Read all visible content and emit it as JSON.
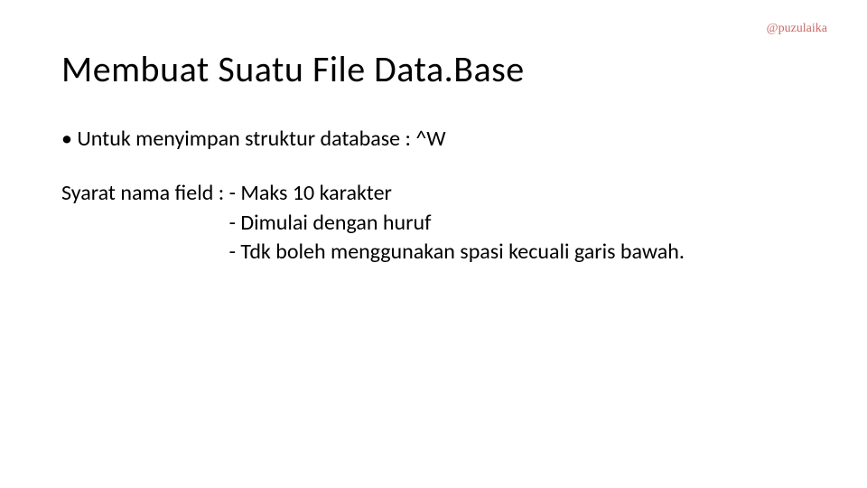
{
  "watermark": "@puzulaika",
  "title": "Membuat Suatu File Data.Base",
  "bullet1": "Untuk menyimpan struktur database : ^W",
  "fieldRule": {
    "lead": "Syarat nama field : ",
    "line1": "- Maks 10 karakter",
    "line2": "- Dimulai dengan huruf",
    "line3": "- Tdk boleh menggunakan spasi kecuali garis bawah."
  }
}
